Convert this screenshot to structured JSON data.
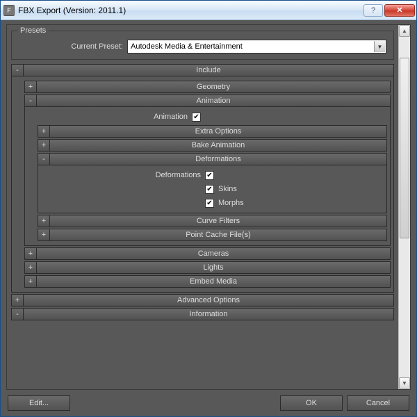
{
  "window": {
    "title": "FBX Export (Version: 2011.1)"
  },
  "presets": {
    "legend": "Presets",
    "label": "Current Preset:",
    "value": "Autodesk Media & Entertainment"
  },
  "sections": {
    "include": {
      "title": "Include",
      "toggle": "-"
    },
    "geometry": {
      "title": "Geometry",
      "toggle": "+"
    },
    "animation": {
      "title": "Animation",
      "toggle": "-",
      "animation_cb": {
        "label": "Animation",
        "checked": true
      },
      "extra_options": {
        "title": "Extra Options",
        "toggle": "+"
      },
      "bake_animation": {
        "title": "Bake Animation",
        "toggle": "+"
      },
      "deformations": {
        "title": "Deformations",
        "toggle": "-",
        "deformations_cb": {
          "label": "Deformations",
          "checked": true
        },
        "skins_cb": {
          "label": "Skins",
          "checked": true
        },
        "morphs_cb": {
          "label": "Morphs",
          "checked": true
        }
      },
      "curve_filters": {
        "title": "Curve Filters",
        "toggle": "+"
      },
      "point_cache": {
        "title": "Point Cache File(s)",
        "toggle": "+"
      }
    },
    "cameras": {
      "title": "Cameras",
      "toggle": "+"
    },
    "lights": {
      "title": "Lights",
      "toggle": "+"
    },
    "embed_media": {
      "title": "Embed Media",
      "toggle": "+"
    },
    "advanced": {
      "title": "Advanced Options",
      "toggle": "+"
    },
    "information": {
      "title": "Information",
      "toggle": "-"
    }
  },
  "buttons": {
    "edit": "Edit...",
    "ok": "OK",
    "cancel": "Cancel"
  }
}
